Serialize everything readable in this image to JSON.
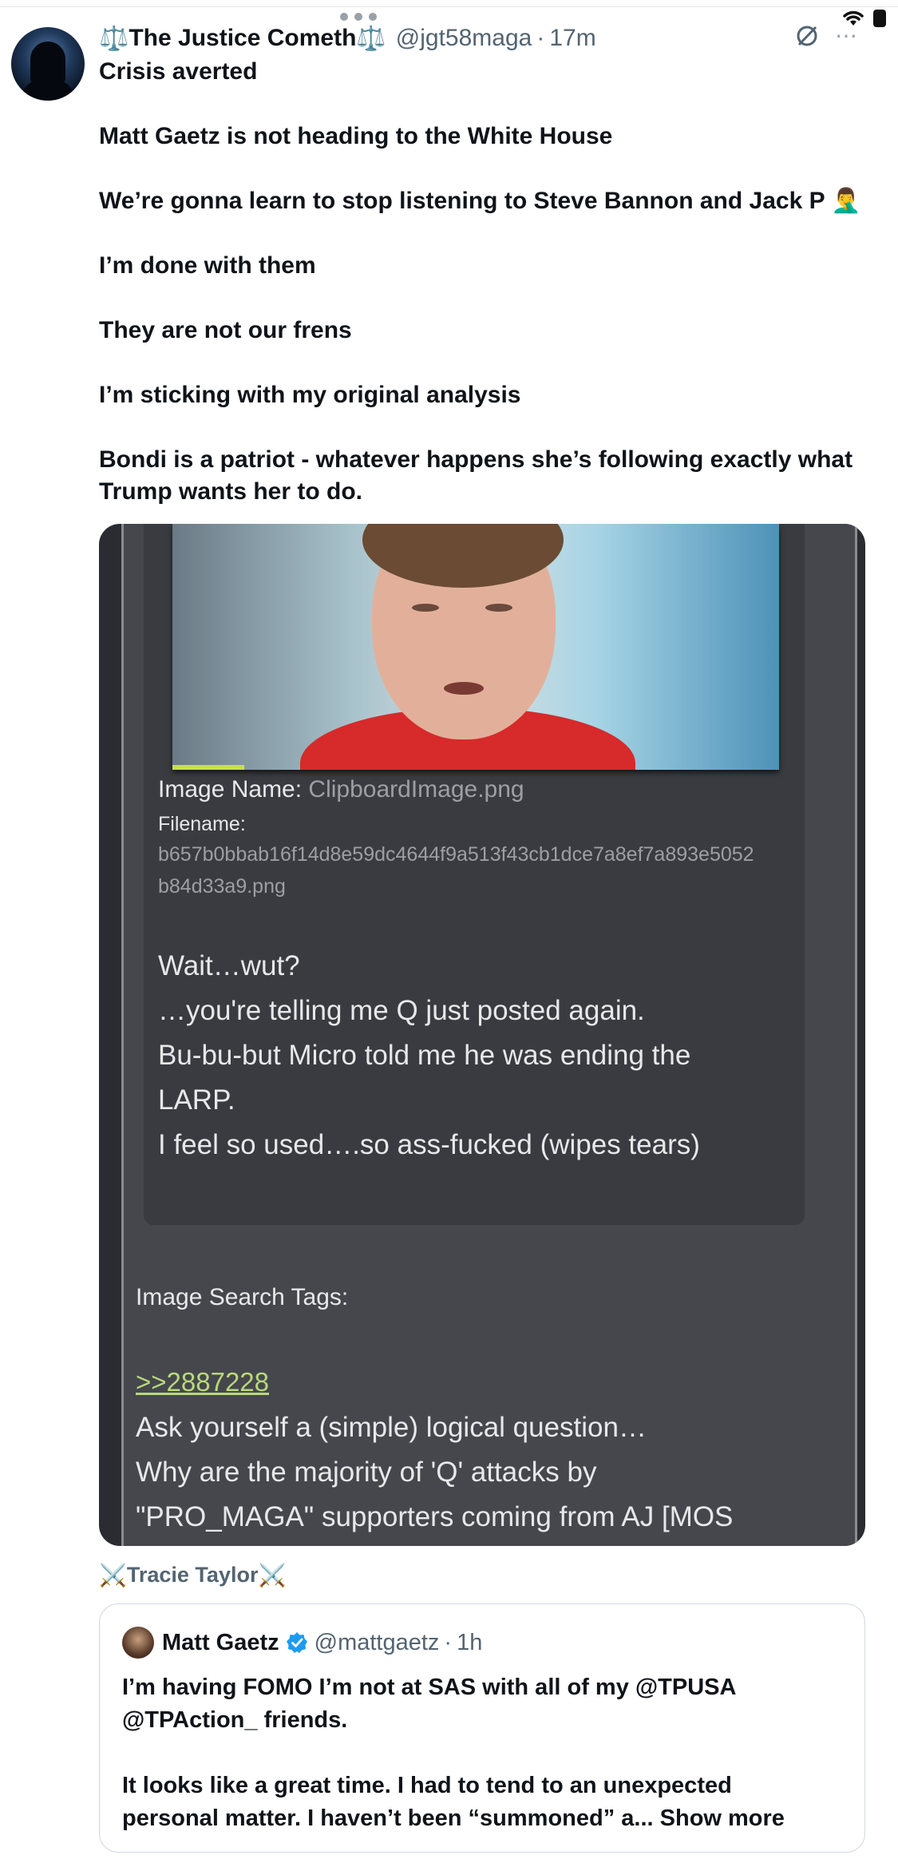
{
  "status_bar": {
    "icons": [
      "more-dots-icon",
      "wifi-icon",
      "battery-icon"
    ]
  },
  "post": {
    "author_name": "The Justice Cometh",
    "name_decoration_left": "⚖️",
    "name_decoration_right": "⚖️",
    "handle": "@jgt58maga",
    "separator": "·",
    "time": "17m",
    "body_lines": [
      "Crisis averted",
      "",
      "Matt Gaetz is not heading to the White House",
      "",
      "We’re gonna learn to stop listening to Steve Bannon and Jack P 🤦‍♂️",
      "",
      "I’m done with them",
      "",
      "They are not our frens",
      "",
      "I’m sticking with my original analysis",
      "",
      "Bondi is a patriot - whatever happens she’s following exactly what",
      "Trump wants her to do."
    ]
  },
  "media": {
    "image_name_label": "Image Name:",
    "image_name_value": "ClipboardImage.png",
    "filename_label": "Filename:",
    "filename_line1": "b657b0bbab16f14d8e59dc4644f9a513f43cb1dce7a8ef7a893e5052",
    "filename_line2": "b84d33a9.png",
    "caption_lines": [
      "Wait…wut?",
      "…you're telling me Q just posted again.",
      "Bu-bu-but Micro told me he was ending the",
      "LARP.",
      "I feel so used….so ass-fucked (wipes tears)"
    ],
    "search_tags_label": "Image Search Tags:",
    "quote_link": ">>2887228",
    "post_lines": [
      "Ask yourself a (simple) logical question…",
      "Why are the majority of 'Q' attacks by",
      "\"PRO_MAGA\" supporters coming from AJ [MOS"
    ]
  },
  "attribution": {
    "icon_left": "⚔️",
    "name": "Tracie Taylor",
    "icon_right": "⚔️"
  },
  "quoted_post": {
    "author_name": "Matt Gaetz",
    "handle": "@mattgaetz",
    "separator": "·",
    "time": "1h",
    "body_line1": "I’m having FOMO I’m not at SAS with all of my @TPUSA",
    "body_line2": "@TPAction_ friends.",
    "body_line3": "It looks like a great time. I had to tend to an unexpected",
    "body_line4_text": "personal matter. I haven’t been “summoned” a...",
    "show_more": "Show more"
  }
}
